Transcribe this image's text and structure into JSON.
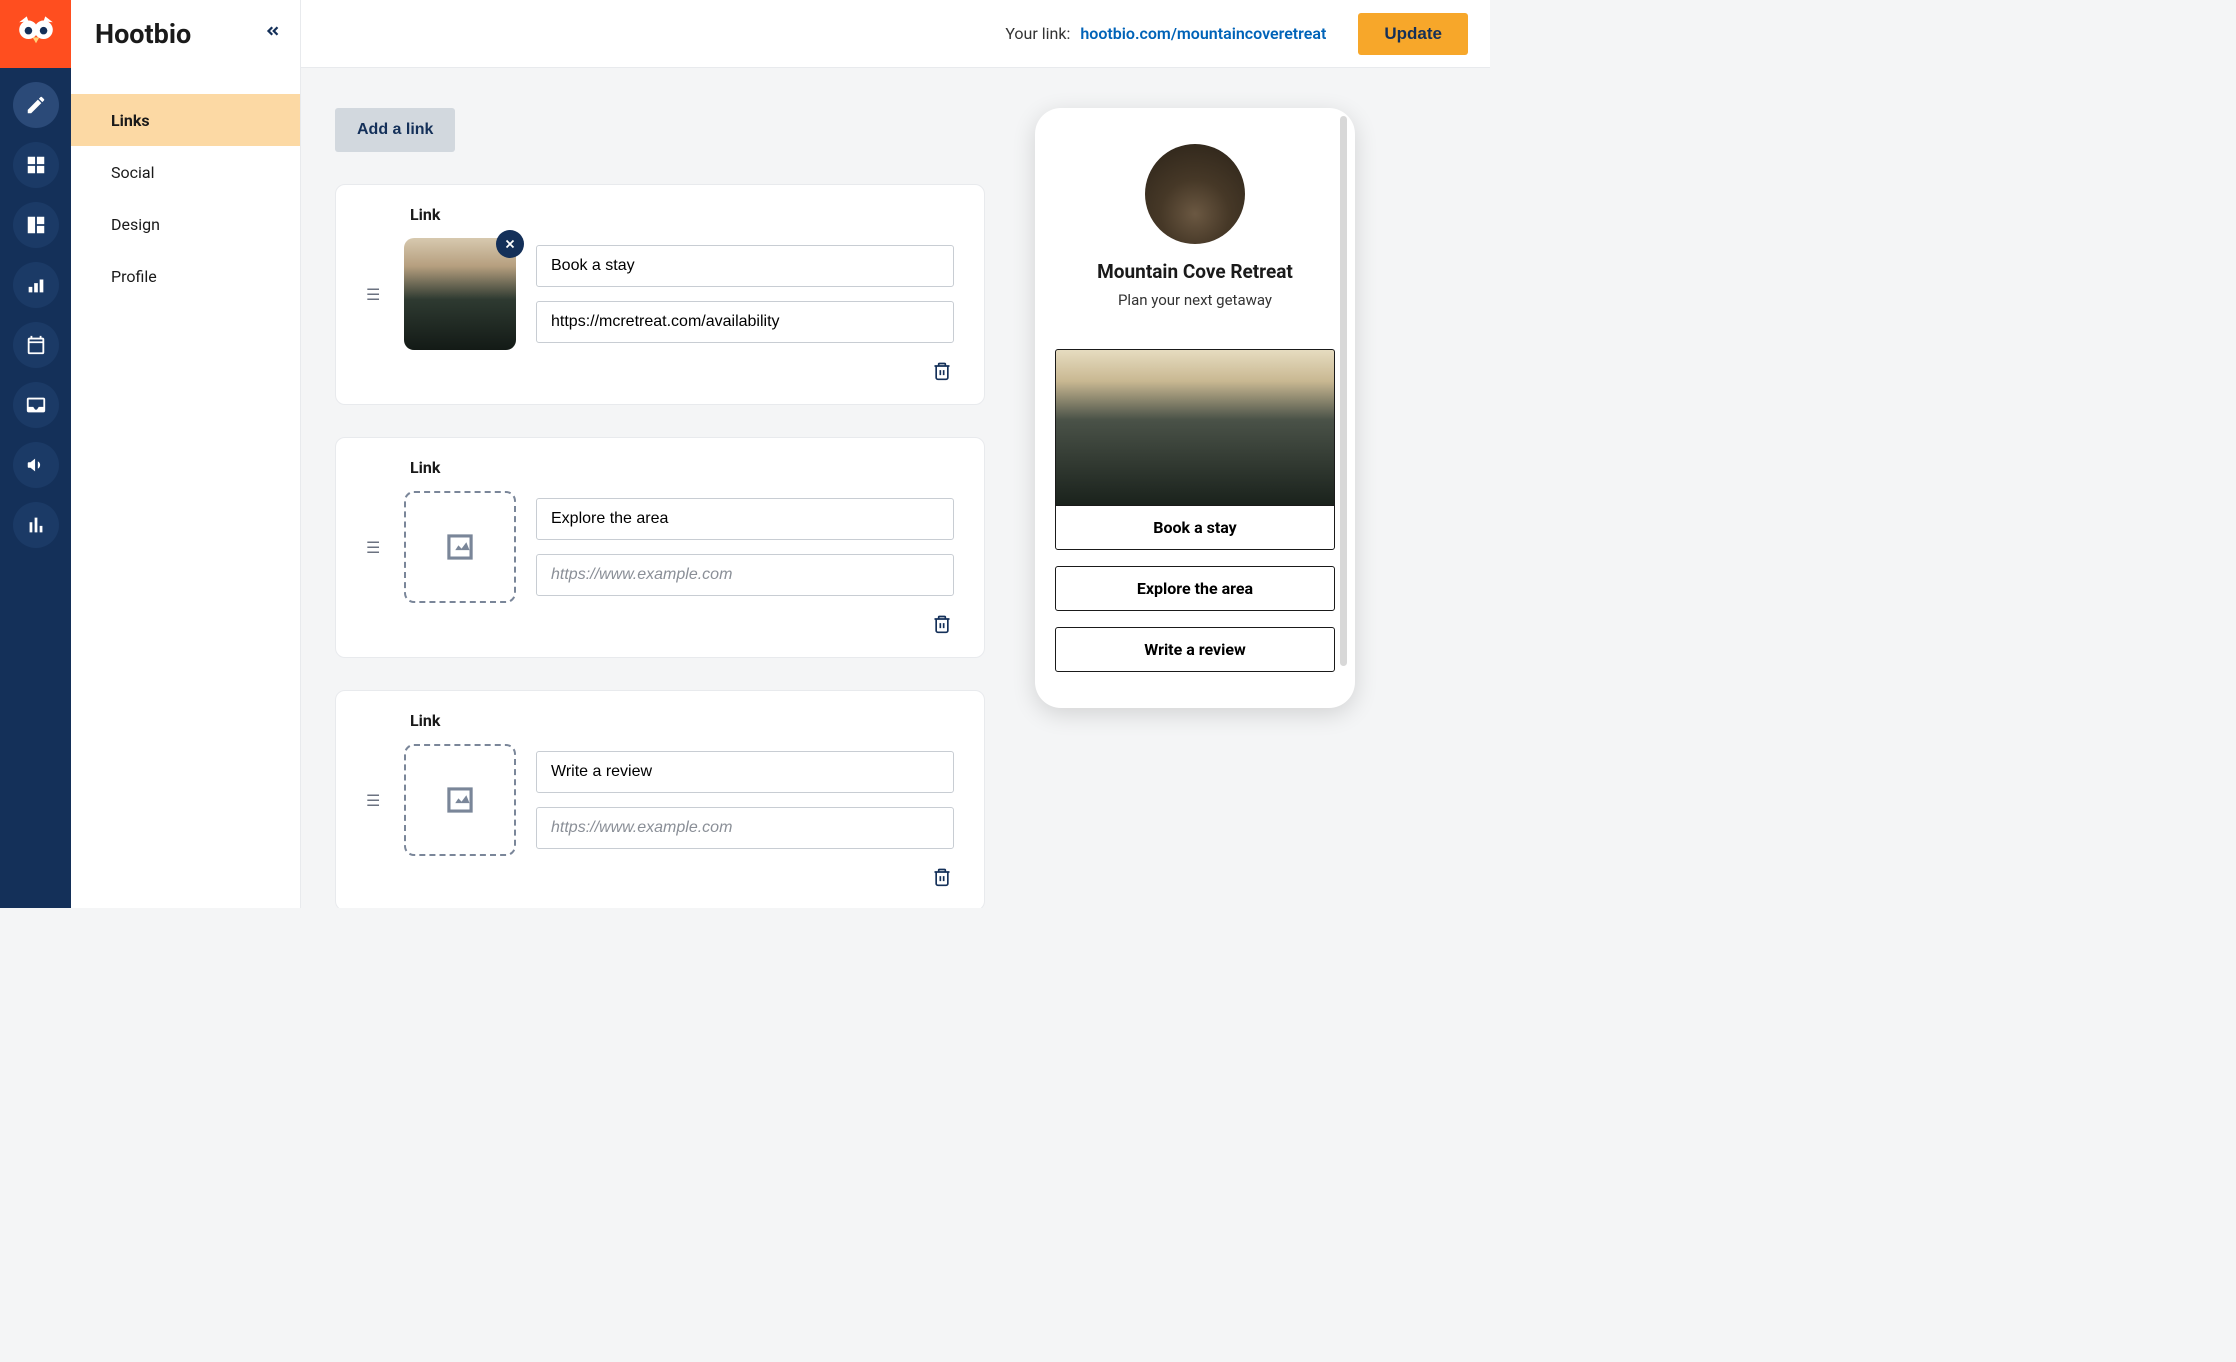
{
  "app_title": "Hootbio",
  "sidebar": {
    "items": [
      {
        "label": "Links",
        "active": true
      },
      {
        "label": "Social",
        "active": false
      },
      {
        "label": "Design",
        "active": false
      },
      {
        "label": "Profile",
        "active": false
      }
    ]
  },
  "topbar": {
    "your_link_label": "Your link:",
    "your_link_url": "hootbio.com/mountaincoveretreat",
    "update_label": "Update"
  },
  "editor": {
    "add_link_label": "Add a link",
    "link_heading": "Link",
    "url_placeholder": "https://www.example.com",
    "links": [
      {
        "title": "Book a stay",
        "url": "https://mcretreat.com/availability",
        "has_image": true
      },
      {
        "title": "Explore the area",
        "url": "",
        "has_image": false
      },
      {
        "title": "Write a review",
        "url": "",
        "has_image": false
      }
    ]
  },
  "preview": {
    "name": "Mountain Cove Retreat",
    "tagline": "Plan your next getaway",
    "buttons": [
      "Book a stay",
      "Explore the area",
      "Write a review"
    ]
  }
}
